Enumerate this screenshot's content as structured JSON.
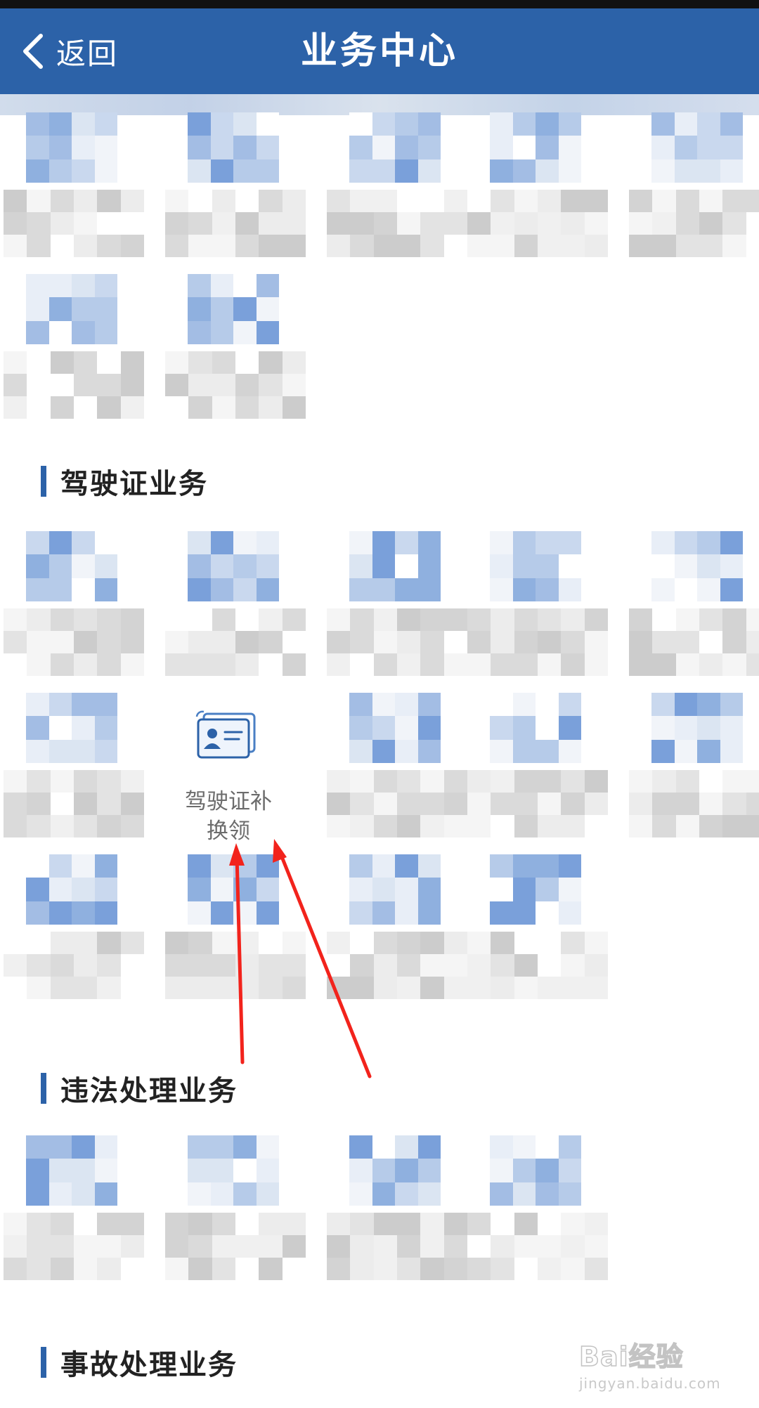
{
  "header": {
    "back_label": "返回",
    "title": "业务中心"
  },
  "sections": [
    {
      "title": "驾驶证业务"
    },
    {
      "title": "违法处理业务"
    },
    {
      "title": "事故处理业务"
    }
  ],
  "featured_tile": {
    "label_line1": "驾驶证补",
    "label_line2": "换领",
    "icon": "driver-license-card-icon"
  },
  "annotation": {
    "arrow_color": "#f2231c",
    "arrow_count": 2
  },
  "watermark": {
    "logo_text": "Bai经验",
    "url_text": "jingyan.baidu.com"
  },
  "colors": {
    "nav_bar": "#2c62a8",
    "section_accent": "#2c62a8",
    "background": "#ffffff"
  }
}
